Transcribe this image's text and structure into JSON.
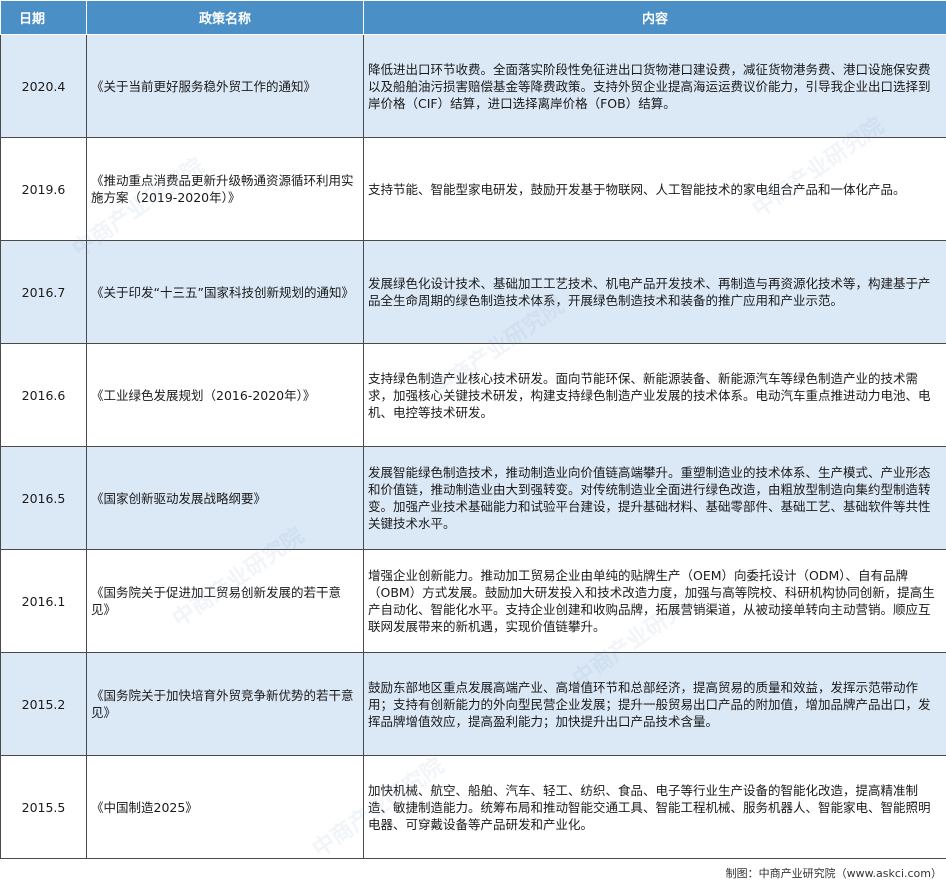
{
  "table": {
    "headers": {
      "date": "日期",
      "name": "政策名称",
      "content": "内容"
    },
    "rows": [
      {
        "date": "2020.4",
        "name": "《关于当前更好服务稳外贸工作的通知》",
        "content": "降低进出口环节收费。全面落实阶段性免征进出口货物港口建设费，减征货物港务费、港口设施保安费以及船舶油污损害赔偿基金等降费政策。支持外贸企业提高海运运费议价能力，引导我企业出口选择到岸价格（CIF）结算，进口选择离岸价格（FOB）结算。"
      },
      {
        "date": "2019.6",
        "name": "《推动重点消费品更新升级畅通资源循环利用实施方案（2019-2020年）》",
        "content": "支持节能、智能型家电研发，鼓励开发基于物联网、人工智能技术的家电组合产品和一体化产品。"
      },
      {
        "date": "2016.7",
        "name": "《关于印发“十三五”国家科技创新规划的通知》",
        "content": "发展绿色化设计技术、基础加工工艺技术、机电产品开发技术、再制造与再资源化技术等，构建基于产品全生命周期的绿色制造技术体系，开展绿色制造技术和装备的推广应用和产业示范。"
      },
      {
        "date": "2016.6",
        "name": "《工业绿色发展规划（2016-2020年）》",
        "content": "支持绿色制造产业核心技术研发。面向节能环保、新能源装备、新能源汽车等绿色制造产业的技术需求，加强核心关键技术研发，构建支持绿色制造产业发展的技术体系。电动汽车重点推进动力电池、电机、电控等技术研发。"
      },
      {
        "date": "2016.5",
        "name": "《国家创新驱动发展战略纲要》",
        "content": "发展智能绿色制造技术，推动制造业向价值链高端攀升。重塑制造业的技术体系、生产模式、产业形态和价值链，推动制造业由大到强转变。对传统制造业全面进行绿色改造，由粗放型制造向集约型制造转变。加强产业技术基础能力和试验平台建设，提升基础材料、基础零部件、基础工艺、基础软件等共性关键技术水平。"
      },
      {
        "date": "2016.1",
        "name": "《国务院关于促进加工贸易创新发展的若干意见》",
        "content": "增强企业创新能力。推动加工贸易企业由单纯的贴牌生产（OEM）向委托设计（ODM）、自有品牌（OBM）方式发展。鼓励加大研发投入和技术改造力度，加强与高等院校、科研机构协同创新，提高生产自动化、智能化水平。支持企业创建和收购品牌，拓展营销渠道，从被动接单转向主动营销。顺应互联网发展带来的新机遇，实现价值链攀升。"
      },
      {
        "date": "2015.2",
        "name": "《国务院关于加快培育外贸竞争新优势的若干意见》",
        "content": "鼓励东部地区重点发展高端产业、高增值环节和总部经济，提高贸易的质量和效益，发挥示范带动作用；支持有创新能力的外向型民营企业发展；提升一般贸易出口产品的附加值，增加品牌产品出口，发挥品牌增值效应，提高盈利能力；加快提升出口产品技术含量。"
      },
      {
        "date": "2015.5",
        "name": "《中国制造2025》",
        "content": "加快机械、航空、船舶、汽车、轻工、纺织、食品、电子等行业生产设备的智能化改造，提高精准制造、敏捷制造能力。统筹布局和推动智能交通工具、智能工程机械、服务机器人、智能家电、智能照明电器、可穿戴设备等产品研发和产业化。"
      }
    ]
  },
  "footer": "制图：中商产业研究院（www.askci.com）",
  "watermark_text": "中商产业研究院",
  "colors": {
    "header": "#4a90c6",
    "stripe": "#dbe8f6",
    "border": "#4a4a4a"
  }
}
